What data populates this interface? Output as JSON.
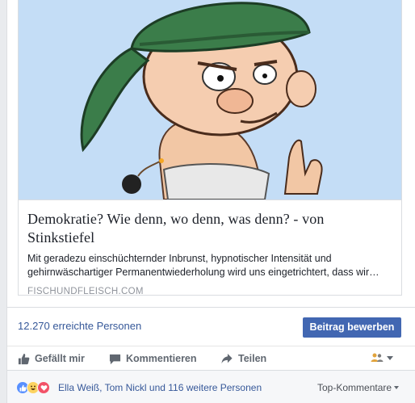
{
  "link": {
    "title": "Demokratie? Wie denn, wo denn, was denn? - von Stinkstiefel",
    "description": "Mit geradezu einschüchternder Inbrunst, hypnotischer Intensität und gehirnwäschartiger Permanentwiederholung wird uns eingetrichtert, dass wir…",
    "domain": "FISCHUNDFLEISCH.COM"
  },
  "stats": {
    "reach": "12.270 erreichte Personen",
    "promote_label": "Beitrag bewerben"
  },
  "actions": {
    "like": "Gefällt mir",
    "comment": "Kommentieren",
    "share": "Teilen"
  },
  "reactions": {
    "summary": "Ella Weiß, Tom Nickl und 116 weitere Personen",
    "sort_label": "Top-Kommentare"
  },
  "colors": {
    "accent": "#4267b2",
    "link": "#365899",
    "image_background": "#c4ddf6"
  },
  "icons": {
    "like": "thumbs-up-icon",
    "comment": "speech-bubble-icon",
    "share": "share-arrow-icon",
    "audience": "friends-icon"
  }
}
